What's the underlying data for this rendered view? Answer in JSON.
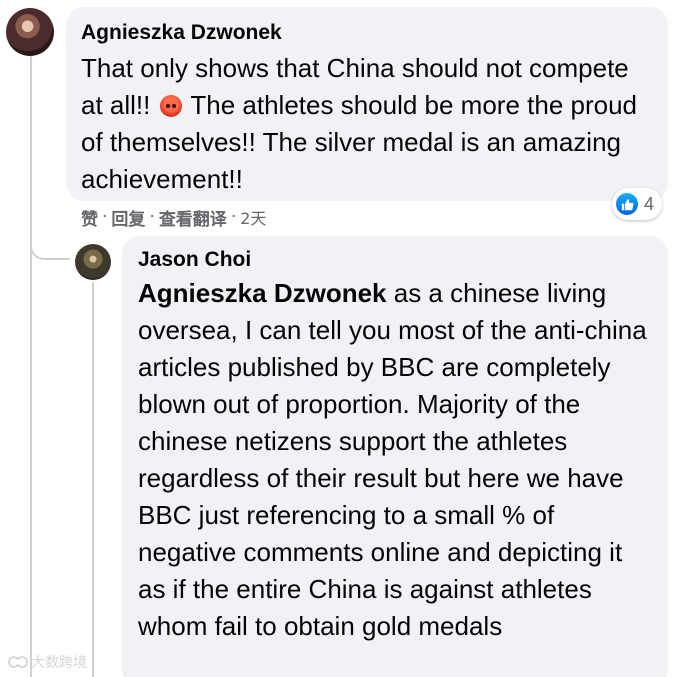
{
  "comment": {
    "author": "Agnieszka Dzwonek",
    "text_part1": "That only shows that China should not compete at all!!",
    "emoji": "angry-face-emoji",
    "text_part2": "The athletes should be more the proud of themselves!! The silver medal is an amazing achievement!!",
    "actions": {
      "like": "赞",
      "reply": "回复",
      "see_translation": "查看翻译",
      "time": "2天"
    },
    "reactions": {
      "icon": "like-icon",
      "count": "4"
    }
  },
  "reply": {
    "author": "Jason Choi",
    "mention": "Agnieszka Dzwonek",
    "text": "as a chinese living oversea, I can tell you most of the anti-china articles published by BBC are completely blown out of proportion. Majority of the chinese netizens support the athletes regardless of their result but here we have BBC just referencing to a small % of negative comments online and depicting it as if the entire China is against athletes whom fail to obtain gold medals"
  },
  "watermark": {
    "text": "大数跨境"
  },
  "colors": {
    "bubble_bg": "#f0f2f5",
    "meta_text": "#65676b",
    "like_blue": "#0866ff",
    "thread_line": "#ced0d4"
  }
}
